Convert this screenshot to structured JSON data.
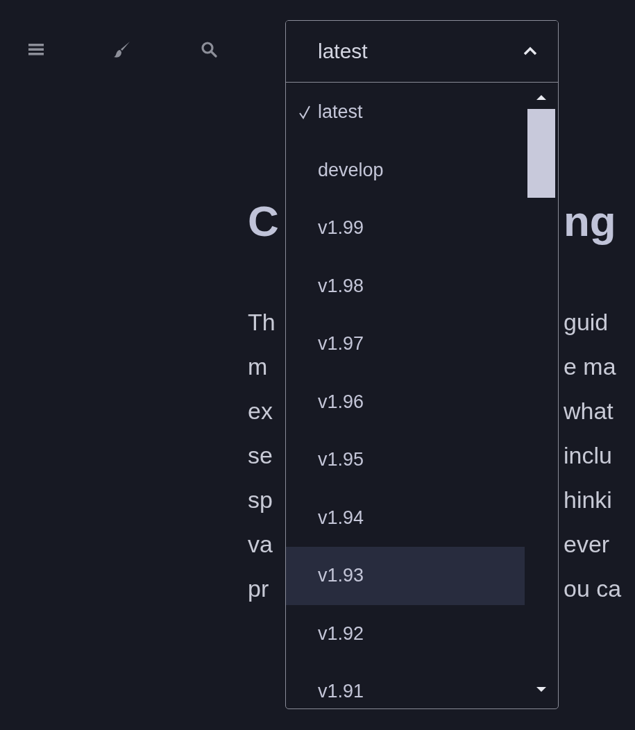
{
  "toolbar": {
    "buttons": [
      {
        "kind": "menu"
      },
      {
        "kind": "brush"
      },
      {
        "kind": "search"
      }
    ]
  },
  "version_select": {
    "value": "latest",
    "expanded": true,
    "options": [
      {
        "label": "latest",
        "selected": true,
        "highlighted": false
      },
      {
        "label": "develop",
        "selected": false,
        "highlighted": false
      },
      {
        "label": "v1.99",
        "selected": false,
        "highlighted": false
      },
      {
        "label": "v1.98",
        "selected": false,
        "highlighted": false
      },
      {
        "label": "v1.97",
        "selected": false,
        "highlighted": false
      },
      {
        "label": "v1.96",
        "selected": false,
        "highlighted": false
      },
      {
        "label": "v1.95",
        "selected": false,
        "highlighted": false
      },
      {
        "label": "v1.94",
        "selected": false,
        "highlighted": false
      },
      {
        "label": "v1.93",
        "selected": false,
        "highlighted": true
      },
      {
        "label": "v1.92",
        "selected": false,
        "highlighted": false
      },
      {
        "label": "v1.91",
        "selected": false,
        "highlighted": false
      }
    ]
  },
  "content": {
    "heading": {
      "left": "C",
      "right": "ng"
    },
    "paragraph_lines": [
      {
        "left": "Th",
        "right": "guid"
      },
      {
        "left": "m",
        "right": "e ma"
      },
      {
        "left": "ex",
        "right": "what"
      },
      {
        "left": "se",
        "right": "inclu"
      },
      {
        "left": "sp",
        "right": "hinki"
      },
      {
        "left": "va",
        "right": "ever"
      },
      {
        "left": "pr",
        "right": "ou ca"
      }
    ]
  }
}
